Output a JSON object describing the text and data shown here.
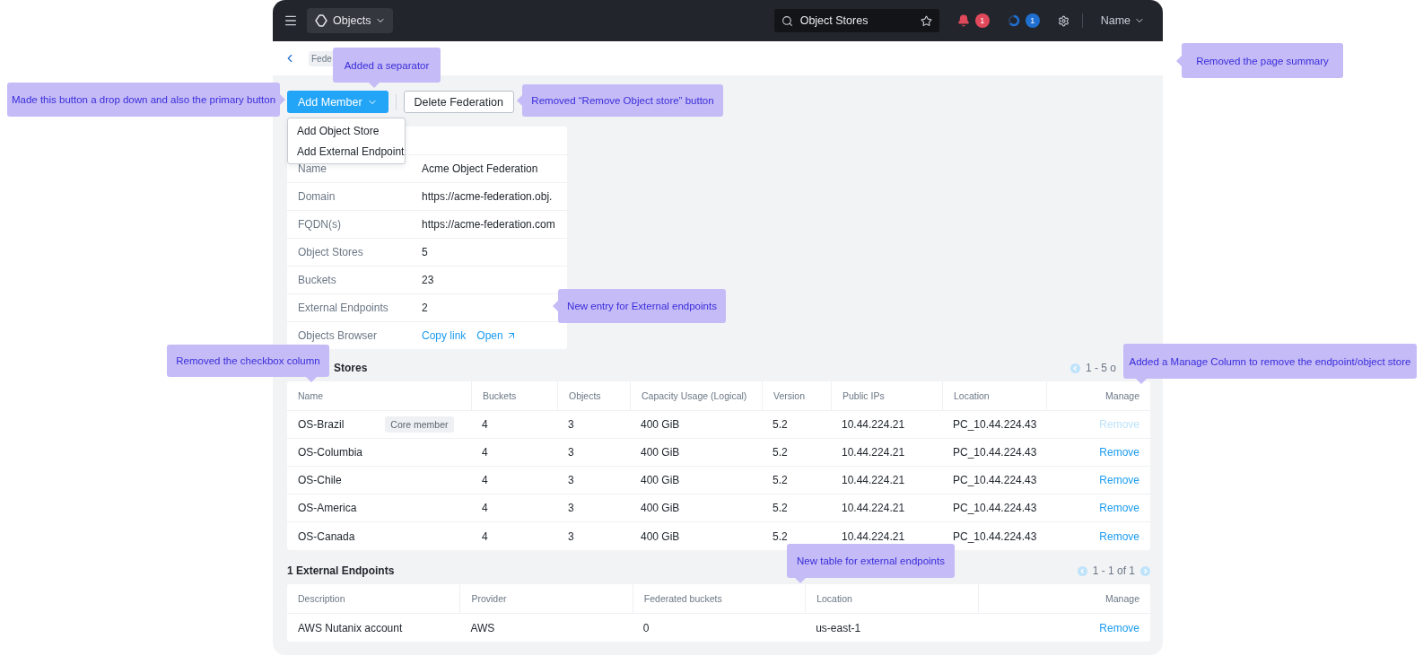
{
  "top_bar": {
    "app_switcher": "Objects",
    "search": {
      "value": "Object Stores"
    },
    "notifications": [
      {
        "kind": "alert",
        "count": "1",
        "color": "#e0495b"
      },
      {
        "kind": "task",
        "count": "1",
        "color": "#1f6fd1"
      }
    ],
    "user": "Name"
  },
  "breadcrumb": {
    "label": "Fede"
  },
  "actions": {
    "primary": "Add Member",
    "secondary": "Delete Federation",
    "menu": {
      "expanded": true,
      "items": [
        "Add Object Store",
        "Add External Endpoint"
      ]
    }
  },
  "details": [
    {
      "label": "Name",
      "value": "Acme Object Federation"
    },
    {
      "label": "Domain",
      "value": "https://acme-federation.obj."
    },
    {
      "label": "FQDN(s)",
      "value": "https://acme-federation.com"
    },
    {
      "label": "Object Stores",
      "value": "5"
    },
    {
      "label": "Buckets",
      "value": "23"
    },
    {
      "label": "External Endpoints",
      "value": "2"
    },
    {
      "label": "Objects Browser",
      "links": [
        "Copy link",
        "Open"
      ]
    }
  ],
  "object_stores": {
    "heading": "Stores",
    "pager": "1 - 5 o",
    "columns": [
      "Name",
      "Buckets",
      "Objects",
      "Capacity Usage (Logical)",
      "Version",
      "Public IPs",
      "Location",
      "Manage"
    ],
    "rows": [
      {
        "cells": [
          "OS-Brazil",
          "4",
          "3",
          "400 GiB",
          "5.2",
          "10.44.224.21",
          "PC_10.44.224.43"
        ],
        "tag": "Core member",
        "action": "Remove",
        "disabled": true
      },
      {
        "cells": [
          "OS-Columbia",
          "4",
          "3",
          "400 GiB",
          "5.2",
          "10.44.224.21",
          "PC_10.44.224.43"
        ],
        "action": "Remove",
        "disabled": false
      },
      {
        "cells": [
          "OS-Chile",
          "4",
          "3",
          "400 GiB",
          "5.2",
          "10.44.224.21",
          "PC_10.44.224.43"
        ],
        "action": "Remove",
        "disabled": false
      },
      {
        "cells": [
          "OS-America",
          "4",
          "3",
          "400 GiB",
          "5.2",
          "10.44.224.21",
          "PC_10.44.224.43"
        ],
        "action": "Remove",
        "disabled": false
      },
      {
        "cells": [
          "OS-Canada",
          "4",
          "3",
          "400 GiB",
          "5.2",
          "10.44.224.21",
          "PC_10.44.224.43"
        ],
        "action": "Remove",
        "disabled": false
      }
    ]
  },
  "external_endpoints": {
    "heading": "1 External Endpoints",
    "pager": "1 - 1 of 1",
    "columns": [
      "Description",
      "Provider",
      "Federated buckets",
      "Location",
      "Manage"
    ],
    "rows": [
      {
        "cells": [
          "AWS Nutanix account",
          "AWS",
          "0",
          "us-east-1"
        ],
        "action": "Remove",
        "disabled": false
      }
    ]
  },
  "annotations": [
    {
      "text": "Added a separator"
    },
    {
      "text": "Made this button a drop down and also the primary button"
    },
    {
      "text": "Removed “Remove Object store” button"
    },
    {
      "text": "Removed the page summary"
    },
    {
      "text": "New entry for External endpoints"
    },
    {
      "text": "Removed the checkbox column"
    },
    {
      "text": "Added a Manage Column to remove the endpoint/object store"
    },
    {
      "text": "New table for external endpoints"
    }
  ]
}
